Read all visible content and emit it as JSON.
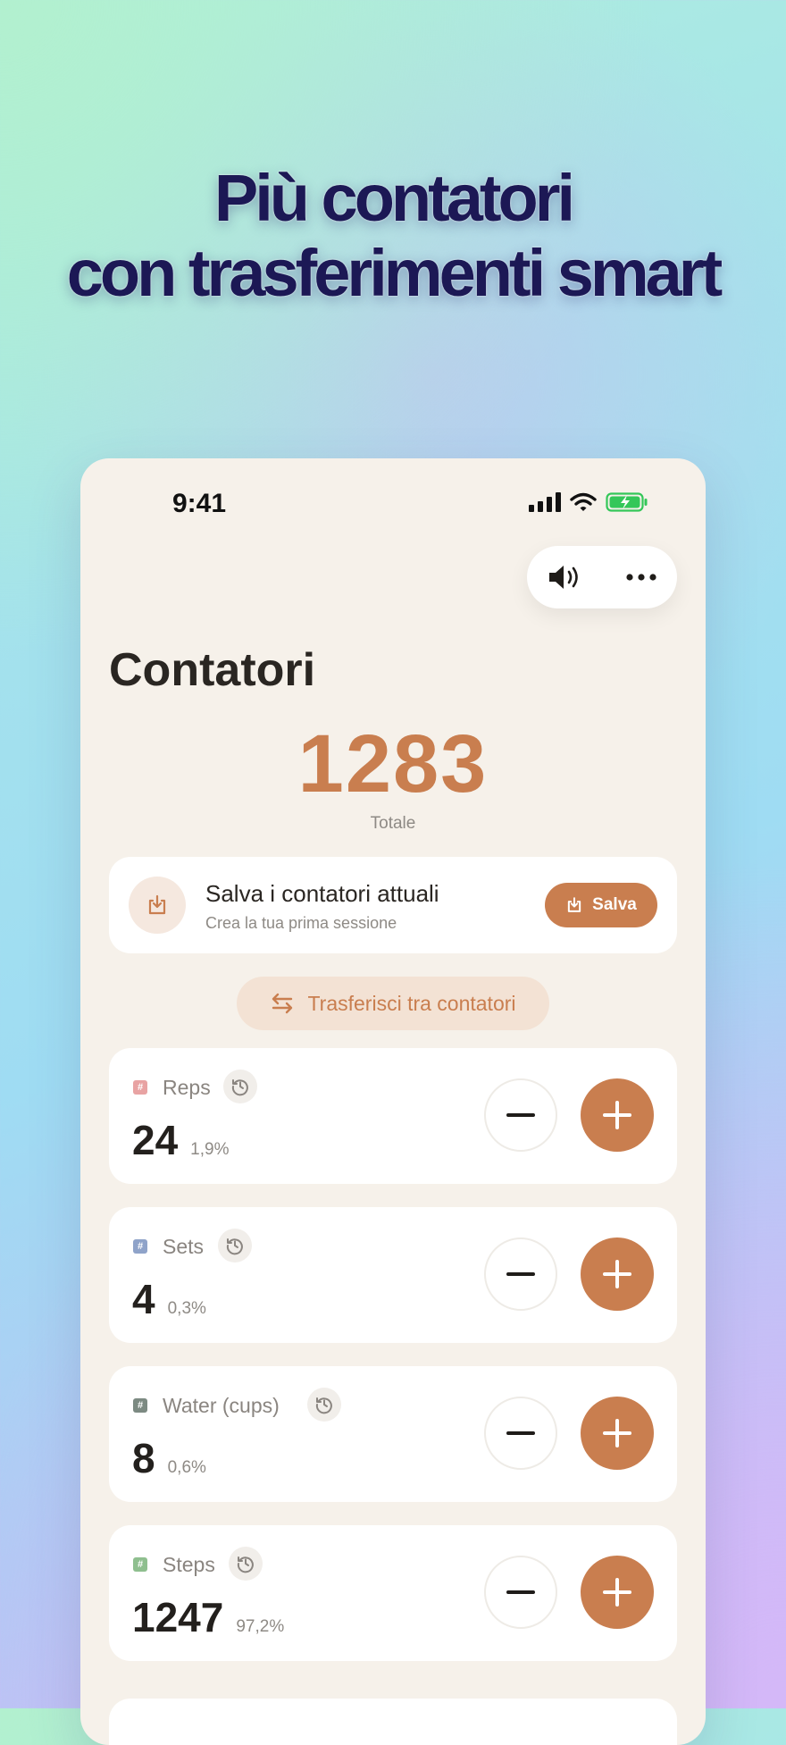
{
  "headline": {
    "line1": "Più contatori",
    "line2": "con trasferimenti smart"
  },
  "status_bar": {
    "time": "9:41"
  },
  "toolbar": {
    "sound_icon": "speaker-icon",
    "more_icon": "more-icon"
  },
  "page": {
    "title": "Contatori"
  },
  "total": {
    "value": "1283",
    "label": "Totale"
  },
  "save_card": {
    "title": "Salva i contatori attuali",
    "subtitle": "Crea la tua prima sessione",
    "button_label": "Salva"
  },
  "transfer": {
    "label": "Trasferisci tra contatori"
  },
  "counters": [
    {
      "name": "Reps",
      "value": "24",
      "percent": "1,9%",
      "tag_color": "#e8a3a3"
    },
    {
      "name": "Sets",
      "value": "4",
      "percent": "0,3%",
      "tag_color": "#8fa3c9"
    },
    {
      "name": "Water (cups)",
      "value": "8",
      "percent": "0,6%",
      "tag_color": "#7c8a82"
    },
    {
      "name": "Steps",
      "value": "1247",
      "percent": "97,2%",
      "tag_color": "#8fbf8f"
    }
  ],
  "colors": {
    "accent": "#c97e4f",
    "title_text": "#1c1855",
    "card_bg": "#f6f1ea"
  }
}
